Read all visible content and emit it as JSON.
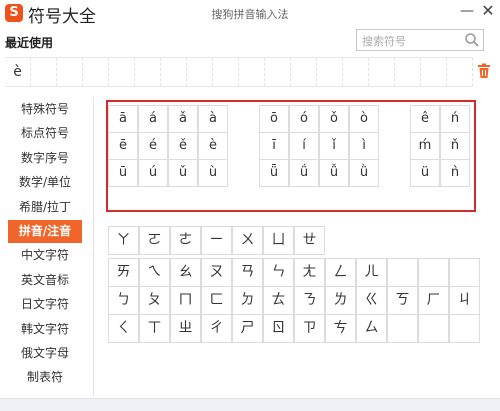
{
  "app": {
    "logo_glyph": "S",
    "title": "符号大全",
    "window_title": "搜狗拼音输入法",
    "minimize_glyph": "—",
    "close_glyph": "✕",
    "accent_color": "#f0652a",
    "highlight_color": "#d32a2a"
  },
  "recent": {
    "label": "最近使用",
    "items": [
      "è",
      "",
      "",
      "",
      "",
      "",
      "",
      "",
      "",
      "",
      "",
      "",
      "",
      "",
      "",
      "",
      "",
      ""
    ]
  },
  "search": {
    "placeholder": "搜索符号",
    "icon": "search-icon"
  },
  "sidebar": {
    "items": [
      {
        "label": "特殊符号"
      },
      {
        "label": "标点符号"
      },
      {
        "label": "数字序号"
      },
      {
        "label": "数学/单位"
      },
      {
        "label": "希腊/拉丁"
      },
      {
        "label": "拼音/注音",
        "active": true
      },
      {
        "label": "中文字符"
      },
      {
        "label": "英文音标"
      },
      {
        "label": "日文字符"
      },
      {
        "label": "韩文字符"
      },
      {
        "label": "俄文字母"
      },
      {
        "label": "制表符"
      }
    ]
  },
  "pinyin": {
    "group_a": [
      "ā",
      "á",
      "ǎ",
      "à",
      "ē",
      "é",
      "ě",
      "è",
      "ū",
      "ú",
      "ǔ",
      "ù"
    ],
    "group_o": [
      "ō",
      "ó",
      "ǒ",
      "ò",
      "ī",
      "í",
      "ǐ",
      "ì",
      "ǖ",
      "ǘ",
      "ǚ",
      "ǜ"
    ],
    "group_e": [
      "ê",
      "ń",
      "ḿ",
      "ň",
      "ü",
      "ǹ"
    ]
  },
  "zhuyin": {
    "top_row": [
      "ㄚ",
      "ㄛ",
      "ㄜ",
      "ㄧ",
      "ㄨ",
      "ㄩ",
      "ㄝ"
    ],
    "main": [
      "ㄞ",
      "ㄟ",
      "ㄠ",
      "ㄡ",
      "ㄢ",
      "ㄣ",
      "ㄤ",
      "ㄥ",
      "ㄦ",
      "",
      "",
      "",
      "ㄅ",
      "ㄆ",
      "ㄇ",
      "ㄈ",
      "ㄉ",
      "ㄊ",
      "ㄋ",
      "ㄌ",
      "ㄍ",
      "ㄎ",
      "ㄏ",
      "ㄐ",
      "ㄑ",
      "ㄒ",
      "ㄓ",
      "ㄔ",
      "ㄕ",
      "ㄖ",
      "ㄗ",
      "ㄘ",
      "ㄙ",
      "",
      "",
      ""
    ]
  }
}
